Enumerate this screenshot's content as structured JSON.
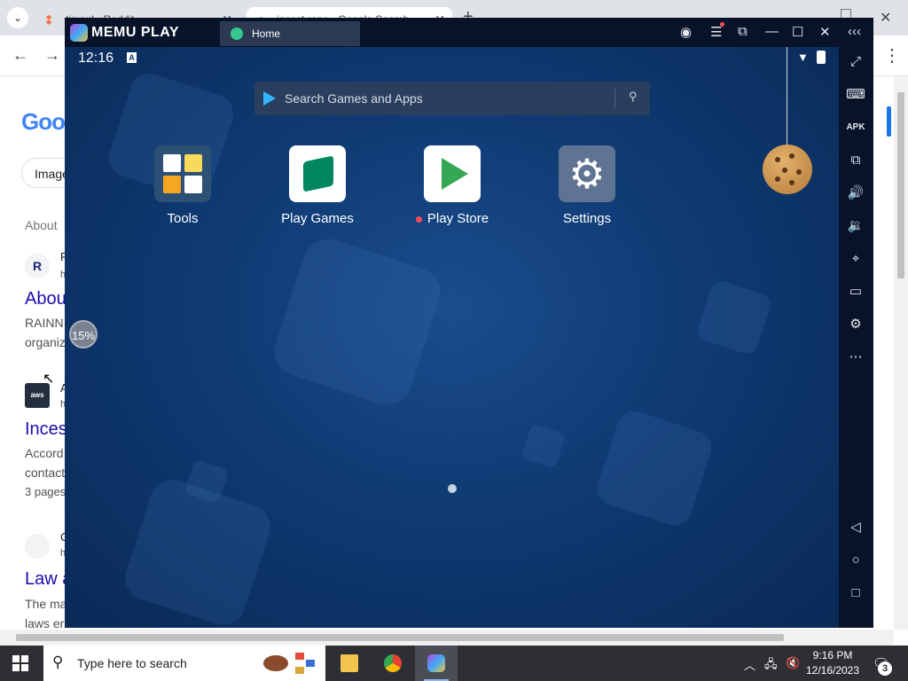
{
  "browser": {
    "tabs": [
      {
        "label": "tinyurl - Reddit",
        "favicon": "reddit-icon"
      },
      {
        "label": "incest rape - Google Search",
        "favicon": "google-icon"
      }
    ],
    "page": {
      "logo_text": "Goo",
      "images_chip": "Image",
      "about_line": "About",
      "results": [
        {
          "icon_letter": "R",
          "site": "R",
          "sub": "h",
          "title": "About",
          "snippet_lines": [
            "RAINN",
            "organiz"
          ]
        },
        {
          "icon_letter": "aws",
          "site": "A",
          "sub": "h",
          "title": "Inces",
          "snippet_lines": [
            "Accord",
            "contact",
            "3 pages"
          ]
        },
        {
          "icon_letter": "",
          "site": "C",
          "sub": "h",
          "title": "Law a",
          "snippet_lines": [
            "The ma",
            "laws er"
          ]
        }
      ]
    }
  },
  "memu": {
    "brand": "MEMU PLAY",
    "tab_label": "Home",
    "status": {
      "time": "12:16"
    },
    "search_placeholder": "Search Games and Apps",
    "apps": [
      {
        "label": "Tools"
      },
      {
        "label": "Play Games"
      },
      {
        "label": "Play Store"
      },
      {
        "label": "Settings"
      }
    ],
    "progress_label": "15%"
  },
  "taskbar": {
    "search_placeholder": "Type here to search",
    "time": "9:16 PM",
    "date": "12/16/2023",
    "notification_count": "3"
  }
}
